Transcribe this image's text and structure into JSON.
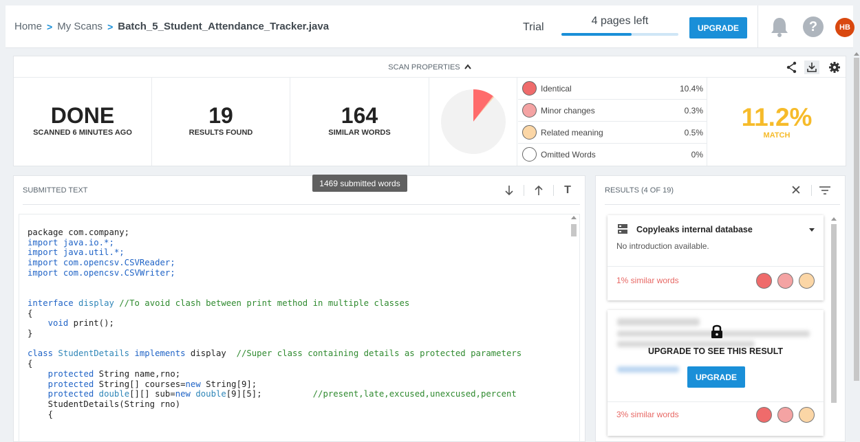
{
  "breadcrumb": {
    "home": "Home",
    "my_scans": "My Scans",
    "current": "Batch_5_Student_Attendance_Tracker.java",
    "separator": ">"
  },
  "header": {
    "trial_label": "Trial",
    "pages_left": "4 pages left",
    "pages_progress_fraction": 0.6,
    "upgrade_label": "UPGRADE",
    "help_glyph": "?",
    "avatar_initials": "HB",
    "accent_color": "#1a8fd8",
    "icons": [
      "bell-icon",
      "help-icon"
    ]
  },
  "scan_properties": {
    "title": "SCAN PROPERTIES",
    "caret": "^",
    "icons": [
      "share-icon",
      "download-icon",
      "gear-icon"
    ],
    "status": {
      "value": "DONE",
      "label": "SCANNED 6 MINUTES AGO"
    },
    "results": {
      "value": "19",
      "label": "RESULTS FOUND"
    },
    "similar": {
      "value": "164",
      "label": "SIMILAR WORDS"
    },
    "legend": [
      {
        "label": "Identical",
        "value": "10.4%",
        "color": "#ef6b6b"
      },
      {
        "label": "Minor changes",
        "value": "0.3%",
        "color": "#f4a3a3"
      },
      {
        "label": "Related meaning",
        "value": "0.5%",
        "color": "#fbd6a6"
      },
      {
        "label": "Omitted Words",
        "value": "0%",
        "color": "#ffffff"
      }
    ],
    "match": {
      "value": "11.2%",
      "label": "MATCH",
      "color": "#f6bb2a"
    }
  },
  "chart_data": {
    "type": "pie",
    "slices": [
      {
        "label": "Identical",
        "value": 10.4,
        "color": "#ff6b6b"
      },
      {
        "label": "Minor changes",
        "value": 0.3,
        "color": "#f4a3a3"
      },
      {
        "label": "Related meaning",
        "value": 0.5,
        "color": "#fbd6a6"
      },
      {
        "label": "Omitted Words",
        "value": 0,
        "color": "#ffffff"
      },
      {
        "label": "Remaining",
        "value": 88.8,
        "color": "#f2f2f2"
      }
    ]
  },
  "submitted": {
    "title": "SUBMITTED TEXT",
    "tooltip": "1469 submitted words",
    "tools": [
      "arrow-down-icon",
      "arrow-up-icon",
      "text-format-icon"
    ],
    "tool_text_glyph": "T",
    "code_lines": [
      [
        [
          "package com.company;",
          "pl"
        ]
      ],
      [
        [
          "import java.io.*;",
          "kw"
        ]
      ],
      [
        [
          "import java.util.*;",
          "kw"
        ]
      ],
      [
        [
          "import com.opencsv.CSVReader;",
          "kw"
        ]
      ],
      [
        [
          "import com.opencsv.CSVWriter;",
          "kw"
        ]
      ],
      [],
      [],
      [
        [
          "interface ",
          "kw"
        ],
        [
          "display ",
          "ty"
        ],
        [
          "//To avoid clash between print method in multiple classes",
          "cm"
        ]
      ],
      [
        [
          "{",
          "pl"
        ]
      ],
      [
        [
          "    ",
          "pl"
        ],
        [
          "void ",
          "kw"
        ],
        [
          "print();",
          "pl"
        ]
      ],
      [
        [
          "}",
          "pl"
        ]
      ],
      [],
      [
        [
          "class ",
          "kw"
        ],
        [
          "StudentDetails ",
          "ty"
        ],
        [
          "implements ",
          "kw"
        ],
        [
          "display  ",
          "pl"
        ],
        [
          "//Super class containing details as protected parameters",
          "cm"
        ]
      ],
      [
        [
          "{",
          "pl"
        ]
      ],
      [
        [
          "    ",
          "pl"
        ],
        [
          "protected ",
          "kw"
        ],
        [
          "String name,rno;",
          "pl"
        ]
      ],
      [
        [
          "    ",
          "pl"
        ],
        [
          "protected ",
          "kw"
        ],
        [
          "String[] courses=",
          "pl"
        ],
        [
          "new ",
          "kw"
        ],
        [
          "String[9];",
          "pl"
        ]
      ],
      [
        [
          "    ",
          "pl"
        ],
        [
          "protected ",
          "kw"
        ],
        [
          "double",
          "ty"
        ],
        [
          "[][] sub=",
          "pl"
        ],
        [
          "new ",
          "kw"
        ],
        [
          "double",
          "ty"
        ],
        [
          "[9][5];          ",
          "pl"
        ],
        [
          "//present,late,excused,unexcused,percent",
          "cm"
        ]
      ],
      [
        [
          "    StudentDetails(String rno)",
          "pl"
        ]
      ],
      [
        [
          "    {",
          "pl"
        ]
      ]
    ]
  },
  "results": {
    "title": "RESULTS (4 OF 19)",
    "close_glyph": "✕",
    "cards": [
      {
        "title": "Copyleaks internal database",
        "intro": "No introduction available.",
        "similar": "1% similar words"
      },
      {
        "locked_message": "UPGRADE TO SEE THIS RESULT",
        "upgrade_label": "UPGRADE",
        "similar": "3% similar words"
      }
    ],
    "dot_colors": [
      "#ef6b6b",
      "#f4a3a3",
      "#fbd6a6"
    ]
  }
}
